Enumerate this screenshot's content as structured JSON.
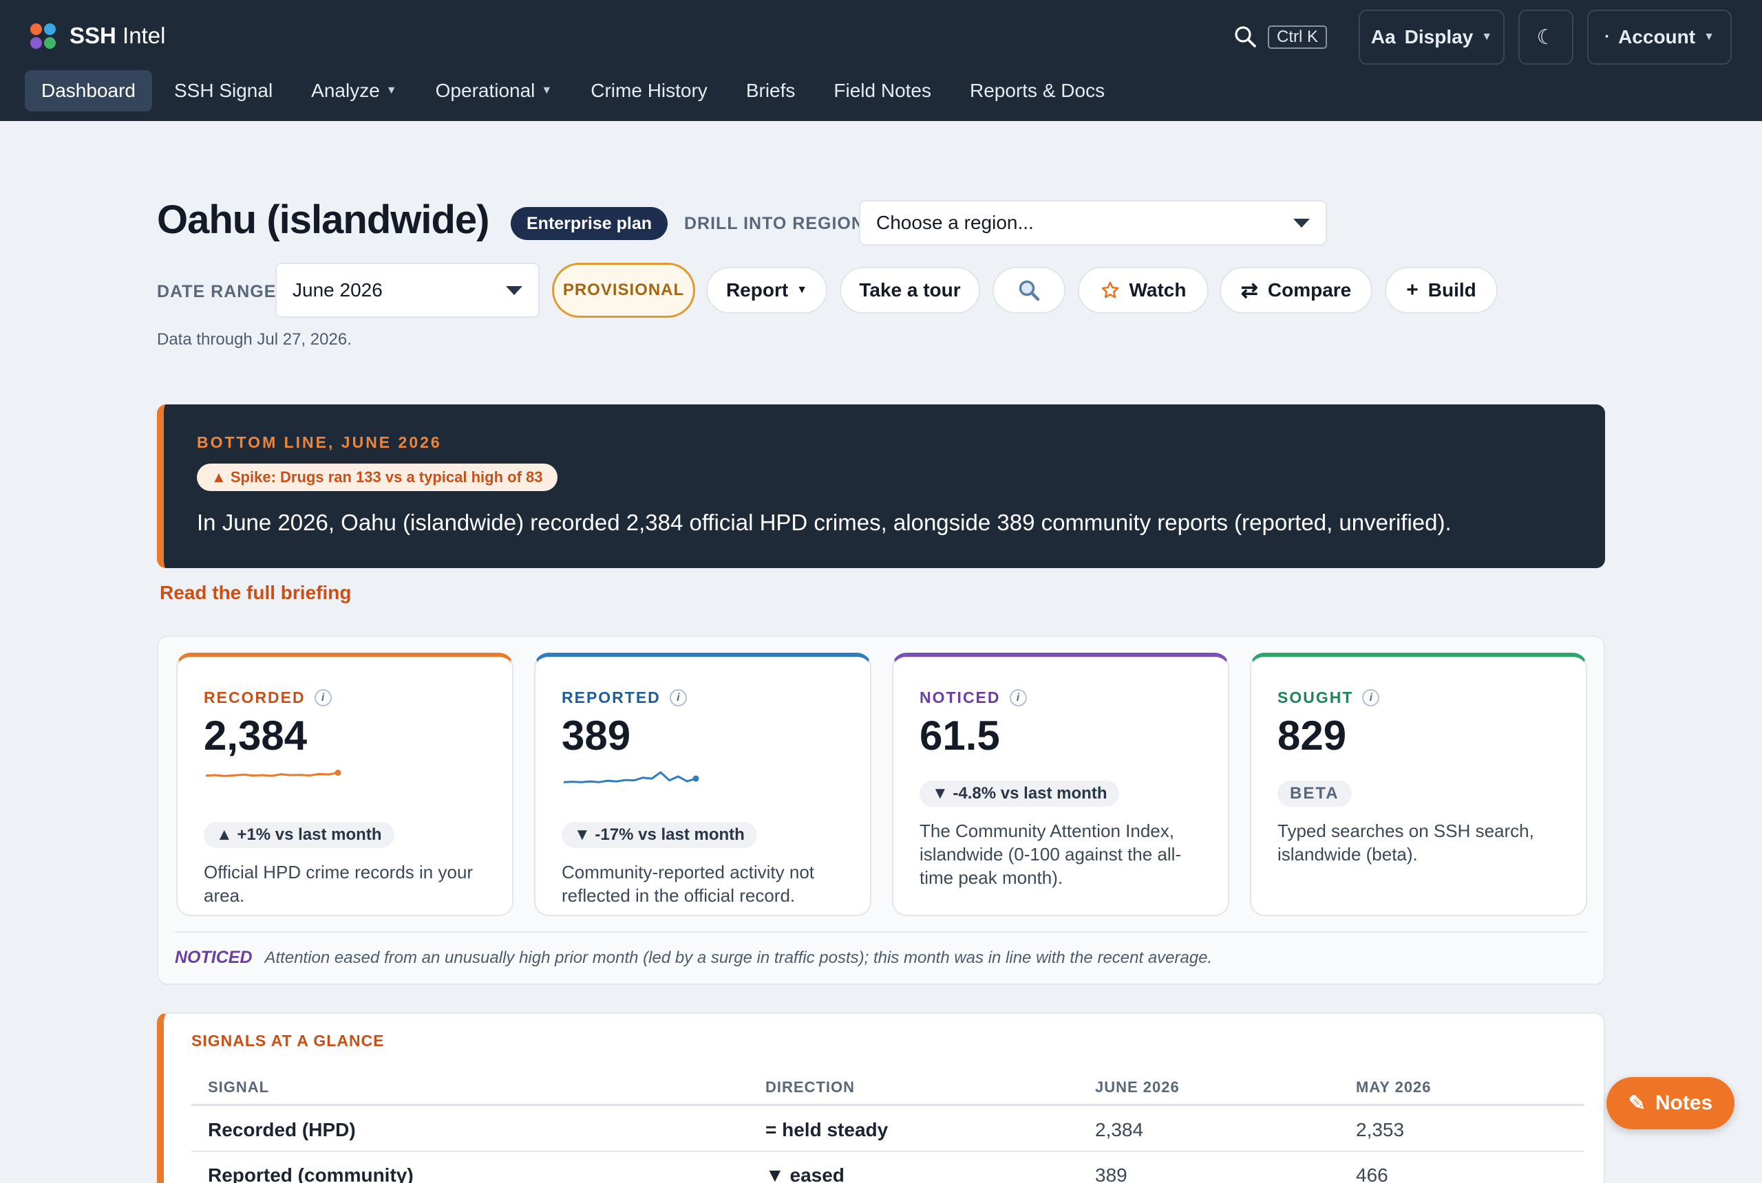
{
  "app": {
    "logo_colors": [
      "#f26b3a",
      "#3aa7e0",
      "#8a5bd0",
      "#43b36a"
    ],
    "name_bold": "SSH",
    "name_rest": "Intel"
  },
  "header": {
    "search_icon": "search-icon",
    "shortcut": "Ctrl K",
    "display_button": {
      "label": "Display",
      "prefix": "Aa"
    },
    "theme_icon": "moon-icon",
    "theme_glyph": "☾",
    "account_button": {
      "label": "Account",
      "bullet": "·"
    }
  },
  "nav": {
    "items": [
      {
        "label": "Dashboard",
        "active": true
      },
      {
        "label": "SSH Signal"
      },
      {
        "label": "Analyze",
        "dropdown": true
      },
      {
        "label": "Operational",
        "dropdown": true
      },
      {
        "label": "Crime History"
      },
      {
        "label": "Briefs"
      },
      {
        "label": "Field Notes"
      },
      {
        "label": "Reports & Docs"
      }
    ]
  },
  "page": {
    "title": "Oahu (islandwide)",
    "plan_badge": "Enterprise plan",
    "drill_label": "DRILL INTO REGION",
    "region_select": {
      "value": "Choose a region..."
    },
    "date_range_label": "DATE RANGE",
    "date_select": {
      "value": "June 2026"
    },
    "provisional_badge": "PROVISIONAL",
    "actions": {
      "report": "Report",
      "tour": "Take a tour",
      "watch": "Watch",
      "compare": "Compare",
      "build": "Build"
    },
    "data_note": "Data through Jul 27, 2026."
  },
  "bottom_line": {
    "eyebrow": "BOTTOM LINE, JUNE 2026",
    "badge": "▲ Spike: Drugs ran 133 vs a typical high of 83",
    "text": "In June 2026, Oahu (islandwide) recorded 2,384 official HPD crimes, alongside 389 community reports (reported, unverified).",
    "link": "Read the full briefing"
  },
  "cards": [
    {
      "key": "recorded",
      "eyebrow": "RECORDED",
      "color": "#ea7a2c",
      "eyebrow_color": "#c9501a",
      "value": "2,384",
      "sparkline": [
        0.45,
        0.5,
        0.42,
        0.48,
        0.55,
        0.46,
        0.5,
        0.44,
        0.58,
        0.5,
        0.52,
        0.47,
        0.6,
        0.56,
        0.72
      ],
      "chip": "▲ +1% vs last month",
      "desc": "Official HPD crime records in your area."
    },
    {
      "key": "reported",
      "eyebrow": "REPORTED",
      "color": "#2f7dc1",
      "eyebrow_color": "#1f5e98",
      "value": "389",
      "sparkline": [
        0.3,
        0.32,
        0.3,
        0.34,
        0.3,
        0.38,
        0.34,
        0.42,
        0.4,
        0.55,
        0.5,
        0.85,
        0.4,
        0.62,
        0.35,
        0.5
      ],
      "chip": "▼ -17% vs last month",
      "desc": "Community-reported activity not reflected in the official record."
    },
    {
      "key": "noticed",
      "eyebrow": "NOTICED",
      "color": "#7a4fb8",
      "eyebrow_color": "#6b3fa0",
      "value": "61.5",
      "chip": "▼ -4.8% vs last month",
      "desc": "The Community Attention Index, islandwide (0-100 against the all-time peak month)."
    },
    {
      "key": "sought",
      "eyebrow": "SOUGHT",
      "color": "#2ea36a",
      "eyebrow_color": "#1f8553",
      "value": "829",
      "chip": "BETA",
      "desc": "Typed searches on SSH search, islandwide (beta)."
    }
  ],
  "noticed_note": {
    "label": "NOTICED",
    "text": "Attention eased from an unusually high prior month (led by a surge in traffic posts); this month was in line with the recent average."
  },
  "signals": {
    "title": "SIGNALS AT A GLANCE",
    "columns": [
      "SIGNAL",
      "DIRECTION",
      "JUNE 2026",
      "MAY 2026"
    ],
    "rows": [
      {
        "signal": "Recorded (HPD)",
        "direction": "= held steady",
        "current": "2,384",
        "previous": "2,353"
      },
      {
        "signal": "Reported (community)",
        "direction": "▼ eased",
        "current": "389",
        "previous": "466"
      }
    ]
  },
  "notes_button": {
    "label": "Notes",
    "icon": "✎"
  }
}
